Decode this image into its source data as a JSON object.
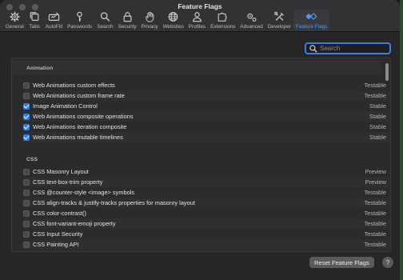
{
  "window": {
    "title": "Feature Flags"
  },
  "toolbar": {
    "items": [
      {
        "label": "General",
        "icon": "gear-icon"
      },
      {
        "label": "Tabs",
        "icon": "tabs-icon"
      },
      {
        "label": "AutoFill",
        "icon": "autofill-icon"
      },
      {
        "label": "Passwords",
        "icon": "key-icon"
      },
      {
        "label": "Search",
        "icon": "search-icon"
      },
      {
        "label": "Security",
        "icon": "lock-icon"
      },
      {
        "label": "Privacy",
        "icon": "hand-icon"
      },
      {
        "label": "Websites",
        "icon": "globe-icon"
      },
      {
        "label": "Profiles",
        "icon": "person-icon"
      },
      {
        "label": "Extensions",
        "icon": "puzzle-icon"
      },
      {
        "label": "Advanced",
        "icon": "gears-icon"
      },
      {
        "label": "Developer",
        "icon": "tools-icon"
      },
      {
        "label": "Feature Flags",
        "icon": "flags-icon",
        "active": true
      }
    ]
  },
  "search": {
    "placeholder": "Search",
    "value": ""
  },
  "sections": [
    {
      "title": "Animation",
      "rows": [
        {
          "name": "Web Animations custom effects",
          "status": "Testable",
          "checked": false
        },
        {
          "name": "Web Animations custom frame rate",
          "status": "Testable",
          "checked": false
        },
        {
          "name": "Image Animation Control",
          "status": "Stable",
          "checked": true
        },
        {
          "name": "Web Animations composite operations",
          "status": "Stable",
          "checked": true
        },
        {
          "name": "Web Animations iteration composite",
          "status": "Stable",
          "checked": true
        },
        {
          "name": "Web Animations mutable timelines",
          "status": "Stable",
          "checked": true
        }
      ]
    },
    {
      "title": "CSS",
      "rows": [
        {
          "name": "CSS Masonry Layout",
          "status": "Preview",
          "checked": false
        },
        {
          "name": "CSS text-box-trim property",
          "status": "Preview",
          "checked": false
        },
        {
          "name": "CSS @counter-style <image> symbols",
          "status": "Testable",
          "checked": false
        },
        {
          "name": "CSS align-tracks & justify-tracks properties for masonry layout",
          "status": "Testable",
          "checked": false
        },
        {
          "name": "CSS color-contrast()",
          "status": "Testable",
          "checked": false
        },
        {
          "name": "CSS font-variant-emoji property",
          "status": "Testable",
          "checked": false
        },
        {
          "name": "CSS Input Security",
          "status": "Testable",
          "checked": false
        },
        {
          "name": "CSS Painting API",
          "status": "Testable",
          "checked": false
        }
      ]
    }
  ],
  "footer": {
    "reset_label": "Reset Feature Flags",
    "help_label": "?"
  },
  "colors": {
    "accent": "#2f7ef0",
    "active_label": "#4a9cf7"
  }
}
